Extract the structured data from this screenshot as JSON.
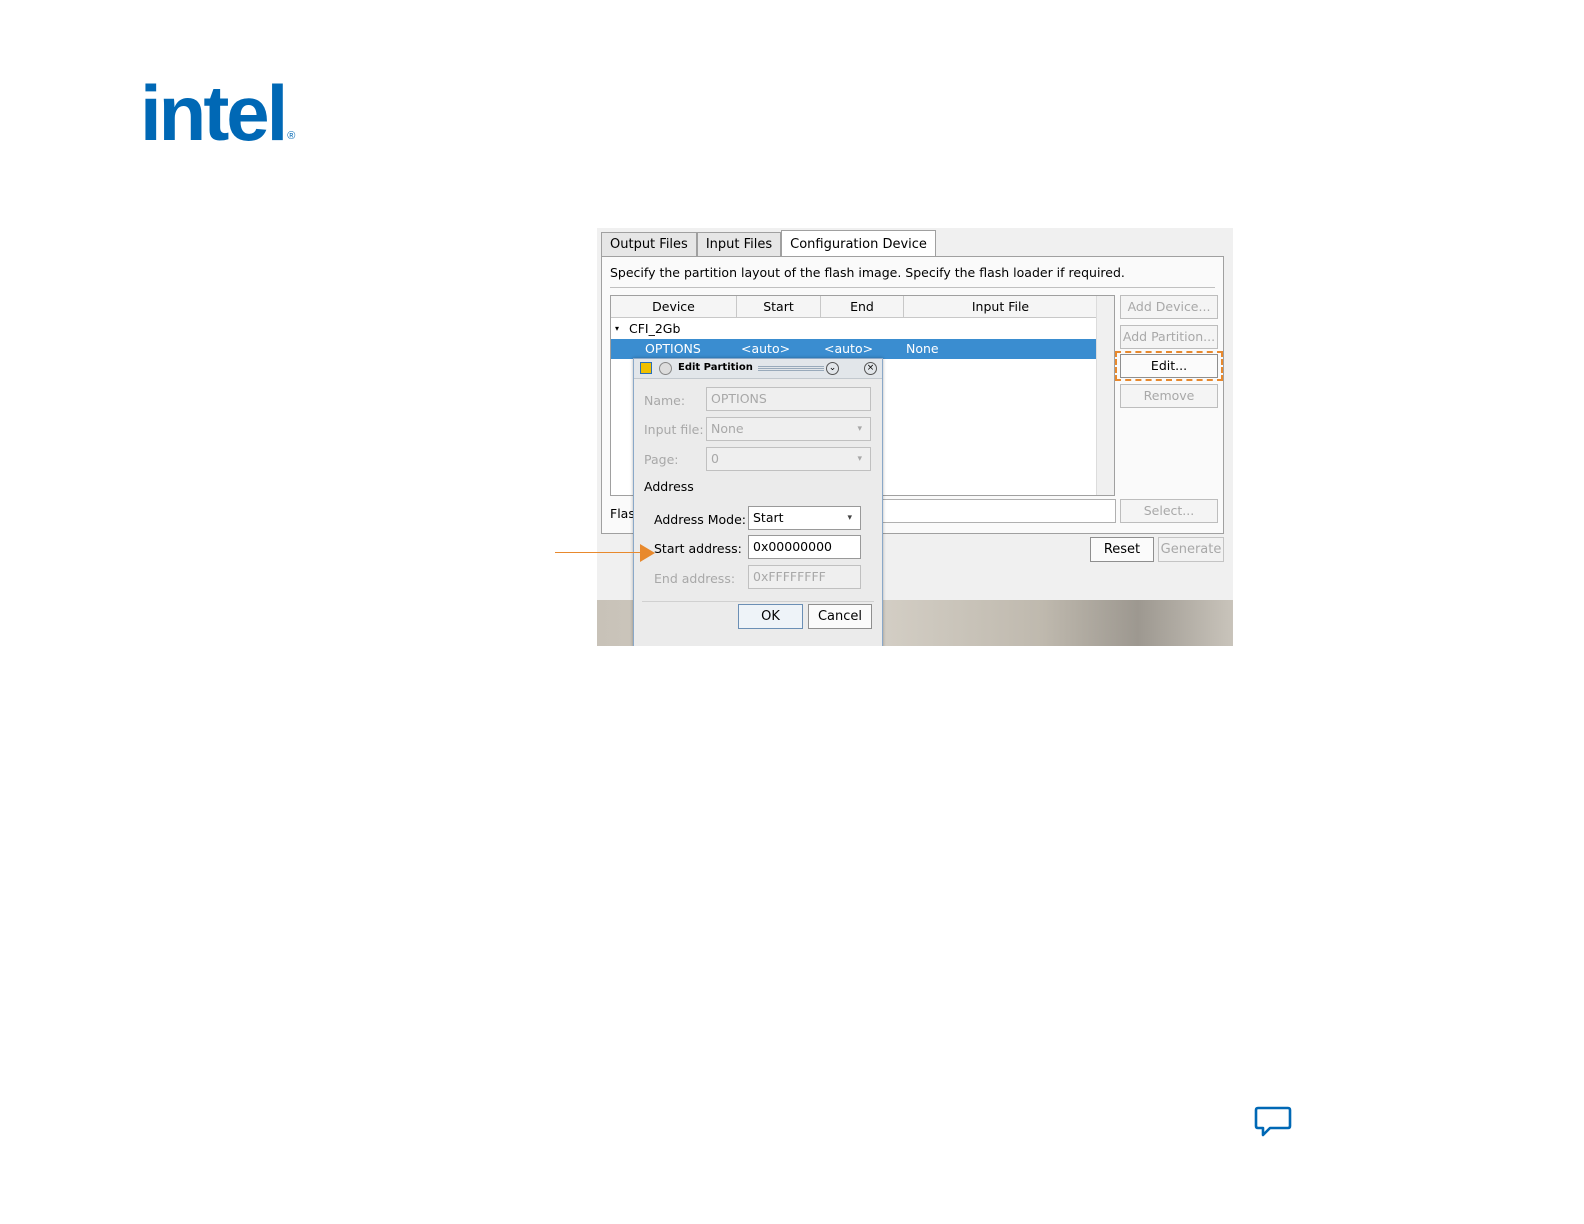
{
  "brand": {
    "logo_text": "intel",
    "reg_mark": "®",
    "logo_color": "#0068b5"
  },
  "accent_color": "#e8892d",
  "tabs": [
    {
      "label": "Output Files",
      "active": false
    },
    {
      "label": "Input Files",
      "active": false
    },
    {
      "label": "Configuration Device",
      "active": true
    }
  ],
  "description": "Specify the partition layout of the flash image. Specify the flash loader if required.",
  "table": {
    "columns": [
      "Device",
      "Start",
      "End",
      "Input File"
    ],
    "device": "CFI_2Gb",
    "selected_row": {
      "device": "OPTIONS",
      "start": "<auto>",
      "end": "<auto>",
      "input_file": "None"
    }
  },
  "side_buttons": {
    "add_device": "Add Device...",
    "add_partition": "Add Partition...",
    "edit": "Edit...",
    "remove": "Remove",
    "select": "Select..."
  },
  "flash_label": "Flash",
  "bottom_buttons": {
    "reset": "Reset",
    "generate": "Generate"
  },
  "dialog": {
    "title": "Edit Partition",
    "name_label": "Name:",
    "name_value": "OPTIONS",
    "input_file_label": "Input file:",
    "input_file_value": "None",
    "page_label": "Page:",
    "page_value": "0",
    "address_section": "Address",
    "address_mode_label": "Address Mode:",
    "address_mode_value": "Start",
    "start_address_label": "Start address:",
    "start_address_value": "0x00000000",
    "end_address_label": "End address:",
    "end_address_value": "0xFFFFFFFF",
    "ok": "OK",
    "cancel": "Cancel"
  }
}
